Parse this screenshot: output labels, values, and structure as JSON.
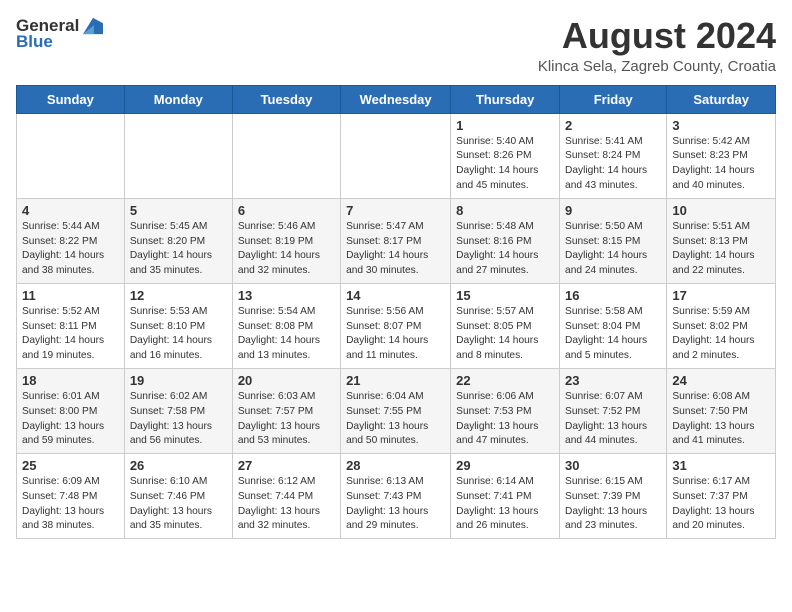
{
  "logo": {
    "general": "General",
    "blue": "Blue"
  },
  "title": "August 2024",
  "subtitle": "Klinca Sela, Zagreb County, Croatia",
  "days_of_week": [
    "Sunday",
    "Monday",
    "Tuesday",
    "Wednesday",
    "Thursday",
    "Friday",
    "Saturday"
  ],
  "weeks": [
    [
      {
        "day": "",
        "info": ""
      },
      {
        "day": "",
        "info": ""
      },
      {
        "day": "",
        "info": ""
      },
      {
        "day": "",
        "info": ""
      },
      {
        "day": "1",
        "info": "Sunrise: 5:40 AM\nSunset: 8:26 PM\nDaylight: 14 hours\nand 45 minutes."
      },
      {
        "day": "2",
        "info": "Sunrise: 5:41 AM\nSunset: 8:24 PM\nDaylight: 14 hours\nand 43 minutes."
      },
      {
        "day": "3",
        "info": "Sunrise: 5:42 AM\nSunset: 8:23 PM\nDaylight: 14 hours\nand 40 minutes."
      }
    ],
    [
      {
        "day": "4",
        "info": "Sunrise: 5:44 AM\nSunset: 8:22 PM\nDaylight: 14 hours\nand 38 minutes."
      },
      {
        "day": "5",
        "info": "Sunrise: 5:45 AM\nSunset: 8:20 PM\nDaylight: 14 hours\nand 35 minutes."
      },
      {
        "day": "6",
        "info": "Sunrise: 5:46 AM\nSunset: 8:19 PM\nDaylight: 14 hours\nand 32 minutes."
      },
      {
        "day": "7",
        "info": "Sunrise: 5:47 AM\nSunset: 8:17 PM\nDaylight: 14 hours\nand 30 minutes."
      },
      {
        "day": "8",
        "info": "Sunrise: 5:48 AM\nSunset: 8:16 PM\nDaylight: 14 hours\nand 27 minutes."
      },
      {
        "day": "9",
        "info": "Sunrise: 5:50 AM\nSunset: 8:15 PM\nDaylight: 14 hours\nand 24 minutes."
      },
      {
        "day": "10",
        "info": "Sunrise: 5:51 AM\nSunset: 8:13 PM\nDaylight: 14 hours\nand 22 minutes."
      }
    ],
    [
      {
        "day": "11",
        "info": "Sunrise: 5:52 AM\nSunset: 8:11 PM\nDaylight: 14 hours\nand 19 minutes."
      },
      {
        "day": "12",
        "info": "Sunrise: 5:53 AM\nSunset: 8:10 PM\nDaylight: 14 hours\nand 16 minutes."
      },
      {
        "day": "13",
        "info": "Sunrise: 5:54 AM\nSunset: 8:08 PM\nDaylight: 14 hours\nand 13 minutes."
      },
      {
        "day": "14",
        "info": "Sunrise: 5:56 AM\nSunset: 8:07 PM\nDaylight: 14 hours\nand 11 minutes."
      },
      {
        "day": "15",
        "info": "Sunrise: 5:57 AM\nSunset: 8:05 PM\nDaylight: 14 hours\nand 8 minutes."
      },
      {
        "day": "16",
        "info": "Sunrise: 5:58 AM\nSunset: 8:04 PM\nDaylight: 14 hours\nand 5 minutes."
      },
      {
        "day": "17",
        "info": "Sunrise: 5:59 AM\nSunset: 8:02 PM\nDaylight: 14 hours\nand 2 minutes."
      }
    ],
    [
      {
        "day": "18",
        "info": "Sunrise: 6:01 AM\nSunset: 8:00 PM\nDaylight: 13 hours\nand 59 minutes."
      },
      {
        "day": "19",
        "info": "Sunrise: 6:02 AM\nSunset: 7:58 PM\nDaylight: 13 hours\nand 56 minutes."
      },
      {
        "day": "20",
        "info": "Sunrise: 6:03 AM\nSunset: 7:57 PM\nDaylight: 13 hours\nand 53 minutes."
      },
      {
        "day": "21",
        "info": "Sunrise: 6:04 AM\nSunset: 7:55 PM\nDaylight: 13 hours\nand 50 minutes."
      },
      {
        "day": "22",
        "info": "Sunrise: 6:06 AM\nSunset: 7:53 PM\nDaylight: 13 hours\nand 47 minutes."
      },
      {
        "day": "23",
        "info": "Sunrise: 6:07 AM\nSunset: 7:52 PM\nDaylight: 13 hours\nand 44 minutes."
      },
      {
        "day": "24",
        "info": "Sunrise: 6:08 AM\nSunset: 7:50 PM\nDaylight: 13 hours\nand 41 minutes."
      }
    ],
    [
      {
        "day": "25",
        "info": "Sunrise: 6:09 AM\nSunset: 7:48 PM\nDaylight: 13 hours\nand 38 minutes."
      },
      {
        "day": "26",
        "info": "Sunrise: 6:10 AM\nSunset: 7:46 PM\nDaylight: 13 hours\nand 35 minutes."
      },
      {
        "day": "27",
        "info": "Sunrise: 6:12 AM\nSunset: 7:44 PM\nDaylight: 13 hours\nand 32 minutes."
      },
      {
        "day": "28",
        "info": "Sunrise: 6:13 AM\nSunset: 7:43 PM\nDaylight: 13 hours\nand 29 minutes."
      },
      {
        "day": "29",
        "info": "Sunrise: 6:14 AM\nSunset: 7:41 PM\nDaylight: 13 hours\nand 26 minutes."
      },
      {
        "day": "30",
        "info": "Sunrise: 6:15 AM\nSunset: 7:39 PM\nDaylight: 13 hours\nand 23 minutes."
      },
      {
        "day": "31",
        "info": "Sunrise: 6:17 AM\nSunset: 7:37 PM\nDaylight: 13 hours\nand 20 minutes."
      }
    ]
  ]
}
